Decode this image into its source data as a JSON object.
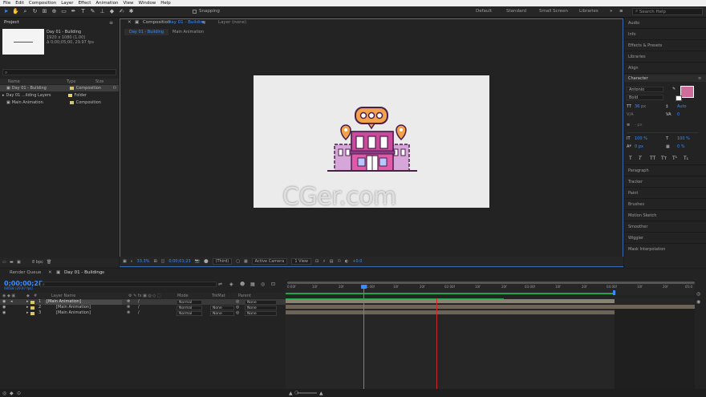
{
  "menu": [
    "File",
    "Edit",
    "Composition",
    "Layer",
    "Effect",
    "Animation",
    "View",
    "Window",
    "Help"
  ],
  "toolbar": {
    "snapping_label": "Snapping",
    "workspaces": [
      "Default",
      "Standard",
      "Small Screen",
      "Libraries"
    ],
    "search_placeholder": "Search Help"
  },
  "project": {
    "tab": "Project",
    "selected_name": "Day 01 - Building",
    "selected_info1": "1920 x 1080 (1.00)",
    "selected_info2": "Δ 0;00;05;00, 29.97 fps",
    "search_icon": "⌕",
    "headers": {
      "name": "Name",
      "type": "Type",
      "size": "Size"
    },
    "items": [
      {
        "name": "Day 01 - Building",
        "type": "Composition",
        "color": "#d8c66a",
        "icon": "▣"
      },
      {
        "name": "Day 01 ...ilding Layers",
        "type": "Folder",
        "color": "#e8d35a",
        "icon": "▸"
      },
      {
        "name": "Main Animation",
        "type": "Composition",
        "color": "#d8c66a",
        "icon": "▣"
      }
    ],
    "bpc": "8 bpc"
  },
  "composition": {
    "tab_prefix": "Composition",
    "tab_name": "Day 01 - Building",
    "layer_tab": "Layer (none)",
    "subtabs": [
      "Day 01 - Building",
      "Main Animation"
    ],
    "zoom": "33.3%",
    "timecode": "0;00;01;23",
    "resolution": "(Third)",
    "camera": "Active Camera",
    "views": "1 View",
    "exposure": "+0.0"
  },
  "watermark": "CGer.com",
  "right_panels": {
    "top": [
      "Audio",
      "Info",
      "Effects & Presets",
      "Libraries",
      "Align"
    ],
    "character_title": "Character",
    "font": "Antonio",
    "style": "Bold",
    "font_size": "36 px",
    "leading": "Auto",
    "tracking": "0",
    "stroke": "- px",
    "vscale": "100 %",
    "hscale": "100 %",
    "baseline": "0 px",
    "tsume": "0 %",
    "styles": [
      "T",
      "T",
      "TT",
      "Tᴛ",
      "T¹",
      "T₁"
    ],
    "bottom": [
      "Paragraph",
      "Tracker",
      "Paint",
      "Brushes",
      "Motion Sketch",
      "Smoother",
      "Wiggler",
      "Mask Interpolation"
    ]
  },
  "timeline": {
    "tabs": [
      "Render Queue",
      "Day 01 - Building"
    ],
    "current_time": "0;00;00;28",
    "current_frames": "00028 (29.97 fps)",
    "headers": {
      "layer_name": "Layer Name",
      "mode": "Mode",
      "trkmat": "TrkMat",
      "parent": "Parent"
    },
    "layers": [
      {
        "num": "1",
        "name": "[Main Animation]",
        "mode": "Normal",
        "trkmat": "",
        "parent": "None"
      },
      {
        "num": "2",
        "name": "[Main Animation]",
        "mode": "Normal",
        "trkmat": "None",
        "parent": "None"
      },
      {
        "num": "3",
        "name": "[Main Animation]",
        "mode": "Normal",
        "trkmat": "None",
        "parent": "None"
      }
    ],
    "ruler_ticks": [
      "0:00f",
      "10f",
      "20f",
      "01:00f",
      "10f",
      "20f",
      "02:00f",
      "10f",
      "20f",
      "03:00f",
      "10f",
      "20f",
      "04:00f",
      "10f",
      "20f",
      "05:0"
    ],
    "colors": {
      "accent": "#3b8bff",
      "layer_bar": "#6d6457",
      "work_area": "#23a34a",
      "end_marker": "#c92b2b"
    }
  }
}
